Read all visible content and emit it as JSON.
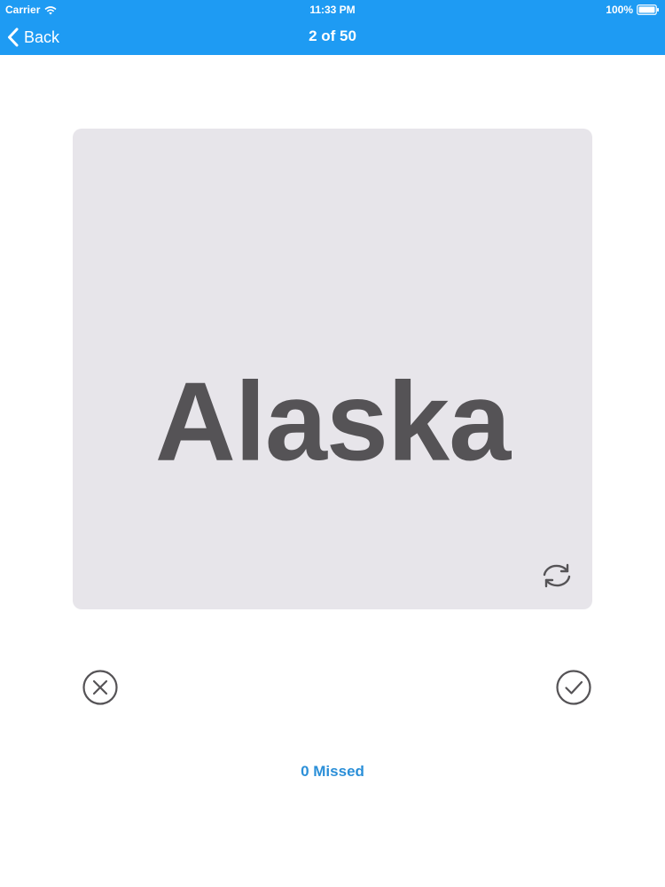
{
  "status_bar": {
    "carrier": "Carrier",
    "time": "11:33 PM",
    "battery": "100%",
    "wifi_icon": "wifi-icon",
    "battery_icon": "battery-icon"
  },
  "nav": {
    "back_label": "Back",
    "title": "2 of 50",
    "back_icon": "chevron-left-icon"
  },
  "card": {
    "word": "Alaska",
    "flip_icon": "refresh-icon"
  },
  "actions": {
    "missed_icon": "x-circle-icon",
    "correct_icon": "check-circle-icon"
  },
  "footer": {
    "missed_count": "0 Missed"
  },
  "colors": {
    "accent": "#1e9bf3",
    "card_bg": "#e7e5ea",
    "card_text": "#555356",
    "link": "#2b8fd8",
    "icon": "#555356"
  }
}
